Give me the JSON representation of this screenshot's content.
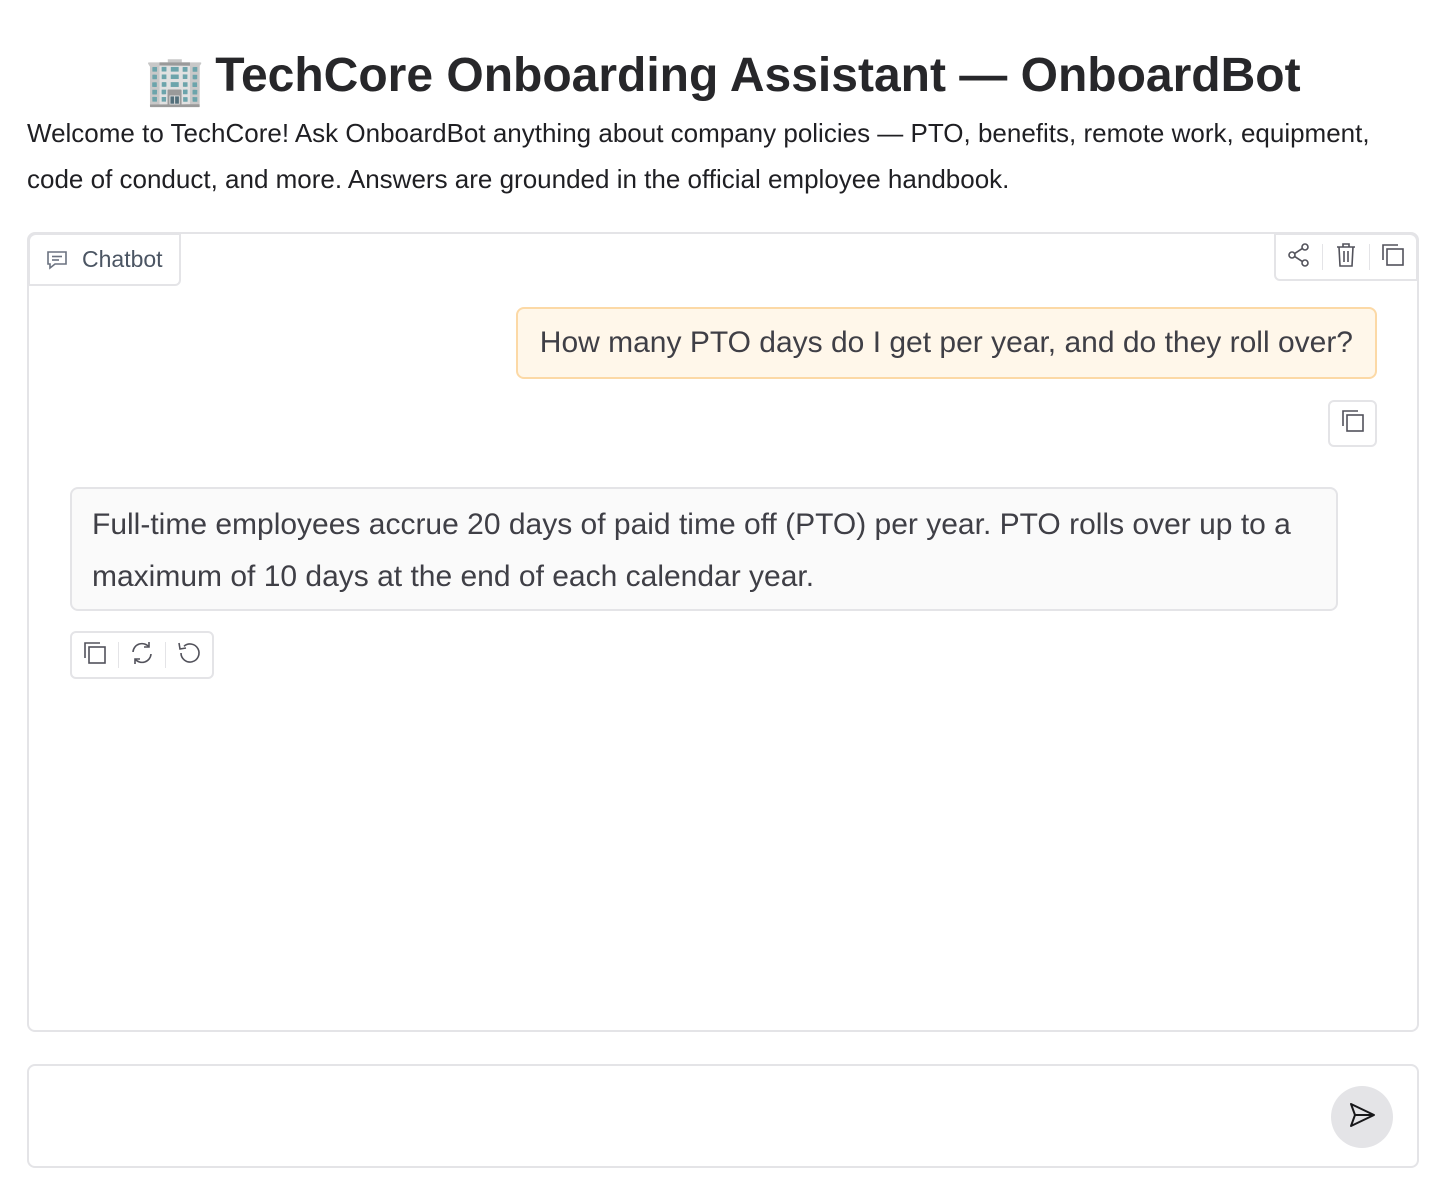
{
  "header": {
    "emoji": "🏢",
    "title": "TechCore Onboarding Assistant — OnboardBot"
  },
  "description": "Welcome to TechCore! Ask OnboardBot anything about company policies — PTO, benefits, remote work, equipment, code of conduct, and more. Answers are grounded in the official employee handbook.",
  "chatbot": {
    "label": "Chatbot",
    "label_icon": "chat-bubble-icon",
    "toolbar": [
      {
        "name": "share-button",
        "icon": "share-icon"
      },
      {
        "name": "clear-button",
        "icon": "trash-icon"
      },
      {
        "name": "copy-all-button",
        "icon": "copy-icon"
      }
    ],
    "messages": [
      {
        "role": "user",
        "text": "How many PTO days do I get per year, and do they roll over?",
        "actions": [
          "copy-icon"
        ]
      },
      {
        "role": "bot",
        "text": "Full-time employees accrue 20 days of paid time off (PTO) per year. PTO rolls over up to a maximum of 10 days at the end of each calendar year.",
        "actions": [
          "copy-icon",
          "retry-icon",
          "undo-icon"
        ]
      }
    ]
  },
  "input": {
    "value": "",
    "placeholder": "",
    "send_icon": "send-icon"
  },
  "colors": {
    "user_bubble_bg": "#fff7ea",
    "user_bubble_border": "#fcd9a6",
    "bot_bubble_bg": "#fafafa",
    "border": "#e4e4e7",
    "send_button_bg": "#e4e4e7"
  }
}
